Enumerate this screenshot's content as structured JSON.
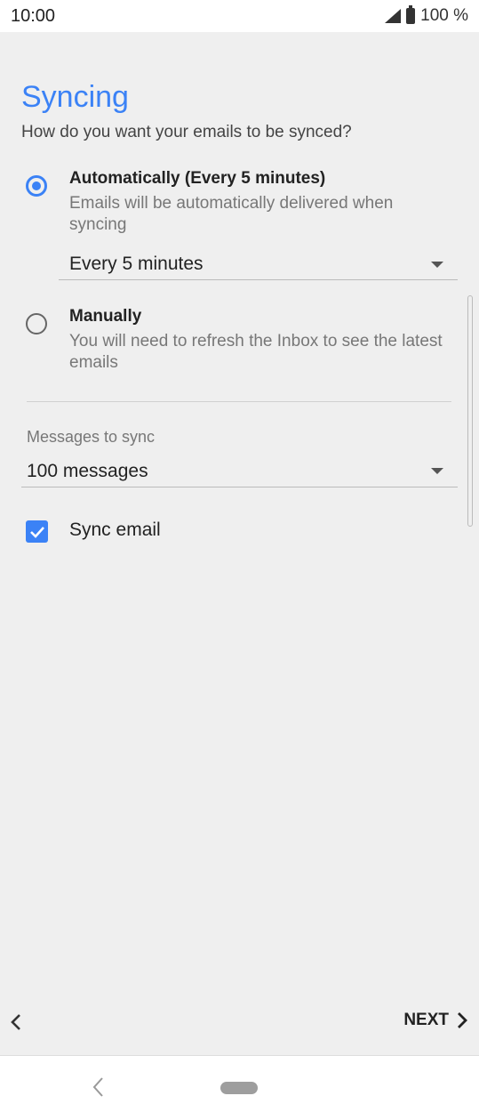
{
  "status": {
    "time": "10:00",
    "battery": "100 %"
  },
  "page": {
    "title": "Syncing",
    "subtitle": "How do you want your emails to be synced?"
  },
  "options": [
    {
      "title": "Automatically (Every 5 minutes)",
      "desc": "Emails will be automatically delivered when syncing",
      "selected": true
    },
    {
      "title": "Manually",
      "desc": "You will need to refresh the Inbox to see the latest emails",
      "selected": false
    }
  ],
  "frequency": {
    "selected": "Every 5 minutes"
  },
  "messages": {
    "label": "Messages to sync",
    "selected": "100 messages"
  },
  "sync_email": {
    "label": "Sync email",
    "checked": true
  },
  "footer": {
    "next_label": "NEXT"
  },
  "colors": {
    "accent": "#3b82f6"
  }
}
